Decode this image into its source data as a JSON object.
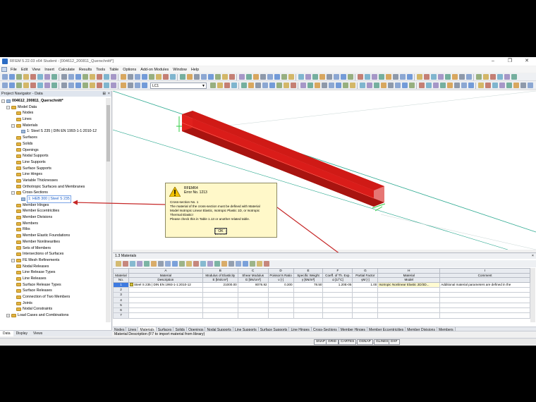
{
  "window": {
    "title": "RFEM 5.22.03 x64 Student - [004612_200811_Querschnitt*]",
    "controls": [
      "–",
      "❐",
      "✕"
    ]
  },
  "menu": {
    "items": [
      "File",
      "Edit",
      "View",
      "Insert",
      "Calculate",
      "Results",
      "Tools",
      "Table",
      "Options",
      "Add-on Modules",
      "Window",
      "Help"
    ]
  },
  "toolbar": {
    "load_case": "LC1"
  },
  "navigator": {
    "title": "Project Navigator - Data",
    "tree": [
      {
        "level": 0,
        "exp": "−",
        "icon": "item",
        "label": "004612_200811_Querschnitt*",
        "bold": true
      },
      {
        "level": 1,
        "exp": "−",
        "icon": "fold",
        "label": "Model Data"
      },
      {
        "level": 2,
        "exp": "",
        "icon": "fold",
        "label": "Nodes"
      },
      {
        "level": 2,
        "exp": "",
        "icon": "fold",
        "label": "Lines"
      },
      {
        "level": 2,
        "exp": "−",
        "icon": "fold",
        "label": "Materials"
      },
      {
        "level": 3,
        "exp": "",
        "icon": "item",
        "label": "1: Steel S 235 | DIN EN 1993-1-1:2010-12"
      },
      {
        "level": 2,
        "exp": "",
        "icon": "fold",
        "label": "Surfaces"
      },
      {
        "level": 2,
        "exp": "",
        "icon": "fold",
        "label": "Solids"
      },
      {
        "level": 2,
        "exp": "",
        "icon": "fold",
        "label": "Openings"
      },
      {
        "level": 2,
        "exp": "",
        "icon": "fold",
        "label": "Nodal Supports"
      },
      {
        "level": 2,
        "exp": "",
        "icon": "fold",
        "label": "Line Supports"
      },
      {
        "level": 2,
        "exp": "",
        "icon": "fold",
        "label": "Surface Supports"
      },
      {
        "level": 2,
        "exp": "",
        "icon": "fold",
        "label": "Line Hinges"
      },
      {
        "level": 2,
        "exp": "",
        "icon": "fold",
        "label": "Variable Thicknesses"
      },
      {
        "level": 2,
        "exp": "",
        "icon": "fold",
        "label": "Orthotropic Surfaces and Membranes"
      },
      {
        "level": 2,
        "exp": "−",
        "icon": "fold",
        "label": "Cross-Sections"
      },
      {
        "level": 3,
        "exp": "",
        "icon": "item",
        "label": "1: HEB 300 | Steel S 235",
        "selected": true
      },
      {
        "level": 2,
        "exp": "",
        "icon": "fold",
        "label": "Member Hinges"
      },
      {
        "level": 2,
        "exp": "",
        "icon": "fold",
        "label": "Member Eccentricities"
      },
      {
        "level": 2,
        "exp": "",
        "icon": "fold",
        "label": "Member Divisions"
      },
      {
        "level": 2,
        "exp": "",
        "icon": "fold",
        "label": "Members"
      },
      {
        "level": 2,
        "exp": "",
        "icon": "fold",
        "label": "Ribs"
      },
      {
        "level": 2,
        "exp": "",
        "icon": "fold",
        "label": "Member Elastic Foundations"
      },
      {
        "level": 2,
        "exp": "",
        "icon": "fold",
        "label": "Member Nonlinearities"
      },
      {
        "level": 2,
        "exp": "",
        "icon": "fold",
        "label": "Sets of Members"
      },
      {
        "level": 2,
        "exp": "",
        "icon": "fold",
        "label": "Intersections of Surfaces"
      },
      {
        "level": 2,
        "exp": "−",
        "icon": "fold",
        "label": "FE Mesh Refinements"
      },
      {
        "level": 2,
        "exp": "",
        "icon": "fold",
        "label": "Nodal Releases"
      },
      {
        "level": 2,
        "exp": "",
        "icon": "fold",
        "label": "Line Release Types"
      },
      {
        "level": 2,
        "exp": "",
        "icon": "fold",
        "label": "Line Releases"
      },
      {
        "level": 2,
        "exp": "",
        "icon": "fold",
        "label": "Surface Release Types"
      },
      {
        "level": 2,
        "exp": "",
        "icon": "fold",
        "label": "Surface Releases"
      },
      {
        "level": 2,
        "exp": "",
        "icon": "fold",
        "label": "Connection of Two Members"
      },
      {
        "level": 2,
        "exp": "",
        "icon": "fold",
        "label": "Joints"
      },
      {
        "level": 2,
        "exp": "",
        "icon": "fold",
        "label": "Nodal Constraints"
      },
      {
        "level": 1,
        "exp": "+",
        "icon": "fold",
        "label": "Load Cases and Combinations"
      }
    ],
    "tabs": [
      "Data",
      "Display",
      "Views"
    ]
  },
  "dialog": {
    "title1": "RFEM64",
    "title2": "Error No. 1213",
    "message": "Cross-section No. 1\nThe material of the cross-section must be defined with Material\nModel Isotropic Linear Elastic, Isotropic Plastic 1D, or Isotropic\nThermal Elastic!\nPlease check this in Table 1.13 or another related table.",
    "ok_label": "OK"
  },
  "table": {
    "title": "1.3 Materials",
    "col_letters": [
      "",
      "A",
      "B",
      "C",
      "D",
      "E",
      "F",
      "G",
      "H",
      "I"
    ],
    "headers1": [
      "Material",
      "Material",
      "Modulus of Elasticity",
      "Shear Modulus",
      "Poisson's Ratio",
      "Specific Weight",
      "Coeff. of Th. Exp.",
      "Partial Factor",
      "Material",
      "Comment"
    ],
    "headers2": [
      "No.",
      "Description",
      "E [kN/cm²]",
      "G [kN/cm²]",
      "ν [-]",
      "γ [kN/m³]",
      "α [1/°C]",
      "γM [-]",
      "Model",
      ""
    ],
    "rows": [
      [
        "1",
        "Steel S 235 | DIN EN 1993-1-1:2010-12",
        "21000.00",
        "8076.92",
        "0.300",
        "78.50",
        "1.20E-05",
        "1.00",
        "Isotropic Nonlinear Elastic 2D/3D...",
        "Additional material parameters are defined in the"
      ],
      [
        "2",
        "",
        "",
        "",
        "",
        "",
        "",
        "",
        "",
        ""
      ],
      [
        "3",
        "",
        "",
        "",
        "",
        "",
        "",
        "",
        "",
        ""
      ],
      [
        "4",
        "",
        "",
        "",
        "",
        "",
        "",
        "",
        "",
        ""
      ],
      [
        "5",
        "",
        "",
        "",
        "",
        "",
        "",
        "",
        "",
        ""
      ],
      [
        "6",
        "",
        "",
        "",
        "",
        "",
        "",
        "",
        "",
        ""
      ],
      [
        "7",
        "",
        "",
        "",
        "",
        "",
        "",
        "",
        "",
        ""
      ]
    ],
    "sheet_tabs": [
      "Nodes",
      "Lines",
      "Materials",
      "Surfaces",
      "Solids",
      "Openings",
      "Nodal Supports",
      "Line Supports",
      "Surface Supports",
      "Line Hinges",
      "Cross-Sections",
      "Member Hinges",
      "Member Eccentricities",
      "Member Divisions",
      "Members"
    ],
    "active_tab": "Materials"
  },
  "status": {
    "hint": "Material Description (F7 to import material from library)",
    "toggles": [
      "SNAP",
      "GRID",
      "CARTES",
      "OSNAP",
      "GLINES",
      "DXF"
    ]
  },
  "viewport": {
    "axis_x": "X",
    "axis_z": "Z"
  },
  "colors": {
    "beam": "#e0201c",
    "beam_dark": "#a81410",
    "arrow": "#c62828",
    "dialog_bg": "#fff8c9",
    "selection": "#1b5fc9"
  }
}
